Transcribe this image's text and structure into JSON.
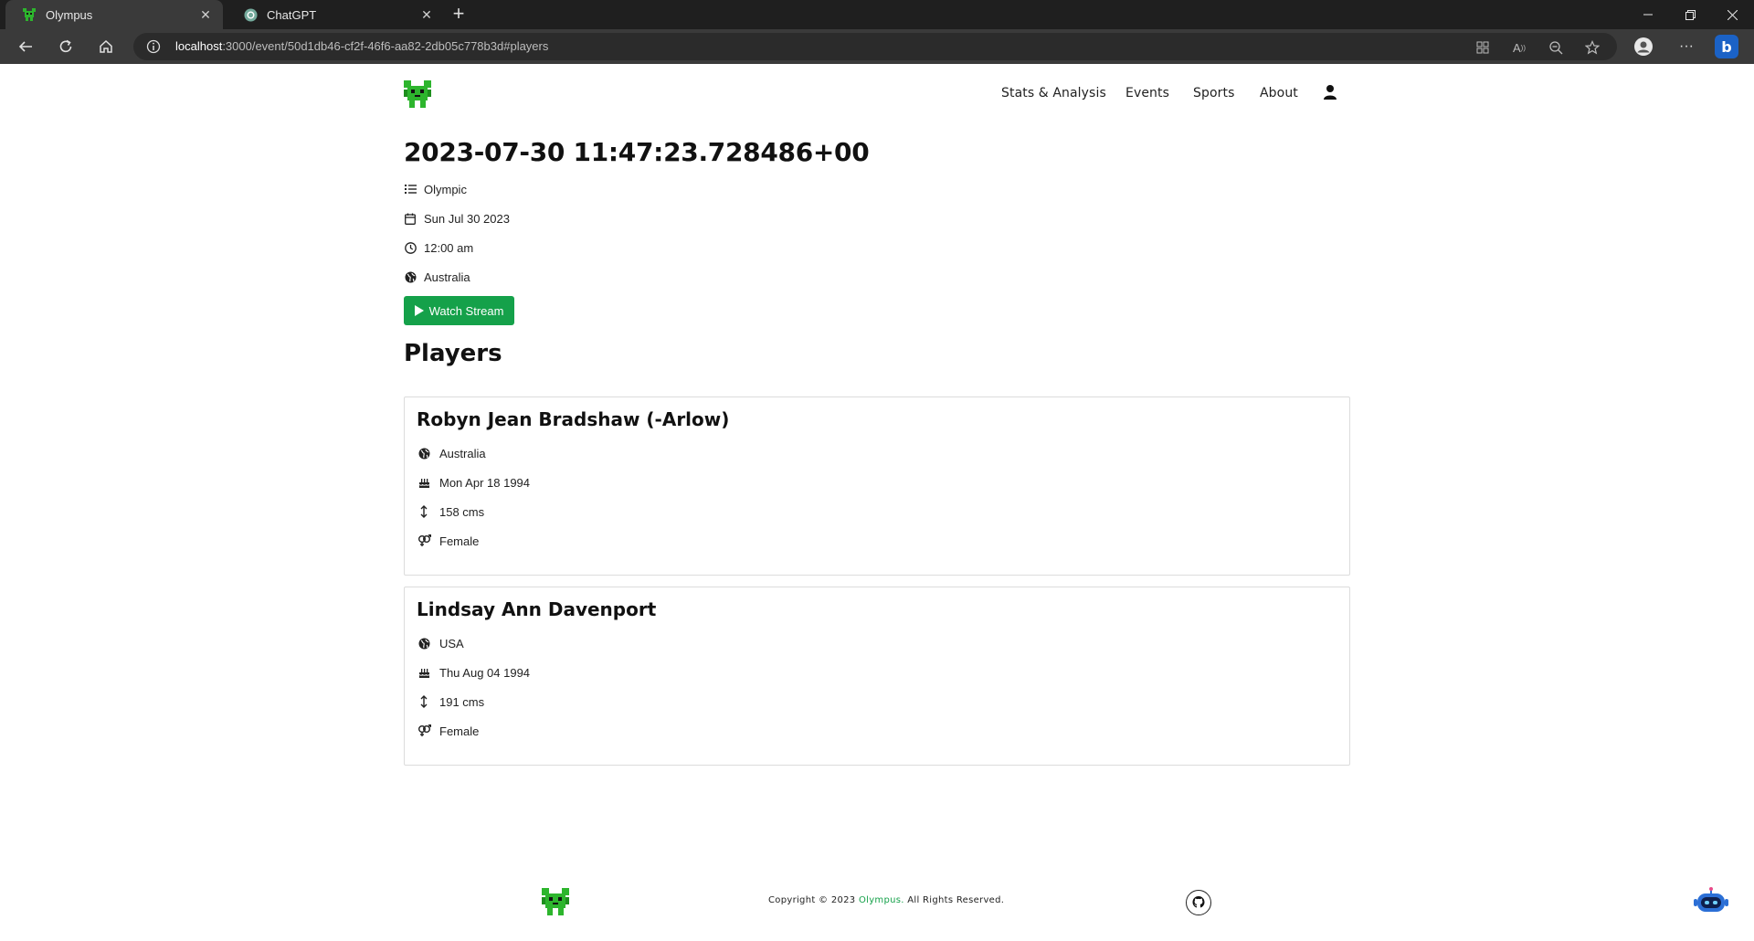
{
  "browser": {
    "tabs": [
      {
        "title": "Olympus",
        "icon": "olympus-favicon",
        "active": true
      },
      {
        "title": "ChatGPT",
        "icon": "chatgpt-favicon",
        "active": false
      }
    ],
    "url_host": "localhost",
    "url_rest": ":3000/event/50d1db46-cf2f-46f6-aa82-2db05c778b3d#players"
  },
  "site": {
    "nav": [
      "Stats & Analysis",
      "Events",
      "Sports",
      "About"
    ],
    "brand_color": "#15a14a"
  },
  "event": {
    "title": "2023-07-30 11:47:23.728486+00",
    "category": "Olympic",
    "date": "Sun Jul 30 2023",
    "time": "12:00 am",
    "location": "Australia",
    "watch_label": "Watch Stream"
  },
  "players_heading": "Players",
  "players": [
    {
      "name": "Robyn Jean Bradshaw (-Arlow)",
      "country": "Australia",
      "dob": "Mon Apr 18 1994",
      "height": "158 cms",
      "gender": "Female"
    },
    {
      "name": "Lindsay Ann Davenport",
      "country": "USA",
      "dob": "Thu Aug 04 1994",
      "height": "191 cms",
      "gender": "Female"
    }
  ],
  "footer": {
    "copyright_prefix": "Copyright © 2023 ",
    "brand": "Olympus.",
    "copyright_suffix": " All Rights Reserved."
  }
}
